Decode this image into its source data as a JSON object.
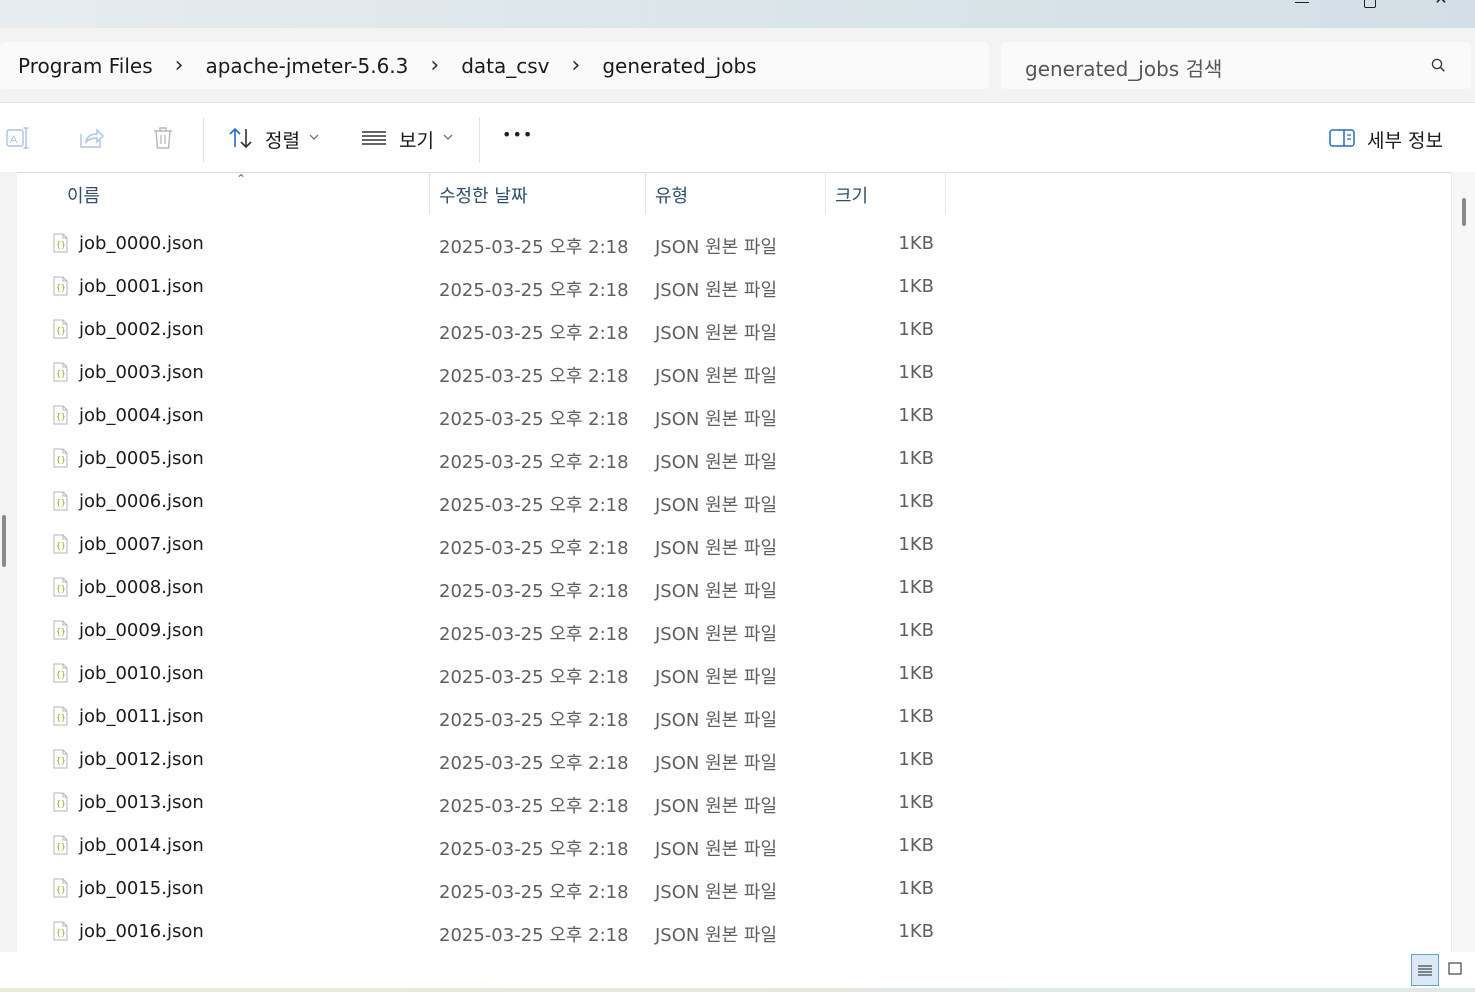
{
  "address": {
    "crumbs": [
      "Program Files",
      "apache-jmeter-5.6.3",
      "data_csv",
      "generated_jobs"
    ]
  },
  "search": {
    "placeholder": "generated_jobs 검색"
  },
  "toolbar": {
    "sort_label": "정렬",
    "view_label": "보기",
    "more_label": "•••",
    "details_label": "세부 정보"
  },
  "columns": {
    "name": "이름",
    "date": "수정한 날짜",
    "type": "유형",
    "size": "크기"
  },
  "files": [
    {
      "name": "job_0000.json",
      "date": "2025-03-25 오후 2:18",
      "type": "JSON 원본 파일",
      "size": "1KB"
    },
    {
      "name": "job_0001.json",
      "date": "2025-03-25 오후 2:18",
      "type": "JSON 원본 파일",
      "size": "1KB"
    },
    {
      "name": "job_0002.json",
      "date": "2025-03-25 오후 2:18",
      "type": "JSON 원본 파일",
      "size": "1KB"
    },
    {
      "name": "job_0003.json",
      "date": "2025-03-25 오후 2:18",
      "type": "JSON 원본 파일",
      "size": "1KB"
    },
    {
      "name": "job_0004.json",
      "date": "2025-03-25 오후 2:18",
      "type": "JSON 원본 파일",
      "size": "1KB"
    },
    {
      "name": "job_0005.json",
      "date": "2025-03-25 오후 2:18",
      "type": "JSON 원본 파일",
      "size": "1KB"
    },
    {
      "name": "job_0006.json",
      "date": "2025-03-25 오후 2:18",
      "type": "JSON 원본 파일",
      "size": "1KB"
    },
    {
      "name": "job_0007.json",
      "date": "2025-03-25 오후 2:18",
      "type": "JSON 원본 파일",
      "size": "1KB"
    },
    {
      "name": "job_0008.json",
      "date": "2025-03-25 오후 2:18",
      "type": "JSON 원본 파일",
      "size": "1KB"
    },
    {
      "name": "job_0009.json",
      "date": "2025-03-25 오후 2:18",
      "type": "JSON 원본 파일",
      "size": "1KB"
    },
    {
      "name": "job_0010.json",
      "date": "2025-03-25 오후 2:18",
      "type": "JSON 원본 파일",
      "size": "1KB"
    },
    {
      "name": "job_0011.json",
      "date": "2025-03-25 오후 2:18",
      "type": "JSON 원본 파일",
      "size": "1KB"
    },
    {
      "name": "job_0012.json",
      "date": "2025-03-25 오후 2:18",
      "type": "JSON 원본 파일",
      "size": "1KB"
    },
    {
      "name": "job_0013.json",
      "date": "2025-03-25 오후 2:18",
      "type": "JSON 원본 파일",
      "size": "1KB"
    },
    {
      "name": "job_0014.json",
      "date": "2025-03-25 오후 2:18",
      "type": "JSON 원본 파일",
      "size": "1KB"
    },
    {
      "name": "job_0015.json",
      "date": "2025-03-25 오후 2:18",
      "type": "JSON 원본 파일",
      "size": "1KB"
    },
    {
      "name": "job_0016.json",
      "date": "2025-03-25 오후 2:18",
      "type": "JSON 원본 파일",
      "size": "1KB"
    }
  ],
  "colors": {
    "accent": "#2b79d6",
    "header_text": "#2e4f6d",
    "json_icon": "#9aa31c"
  }
}
